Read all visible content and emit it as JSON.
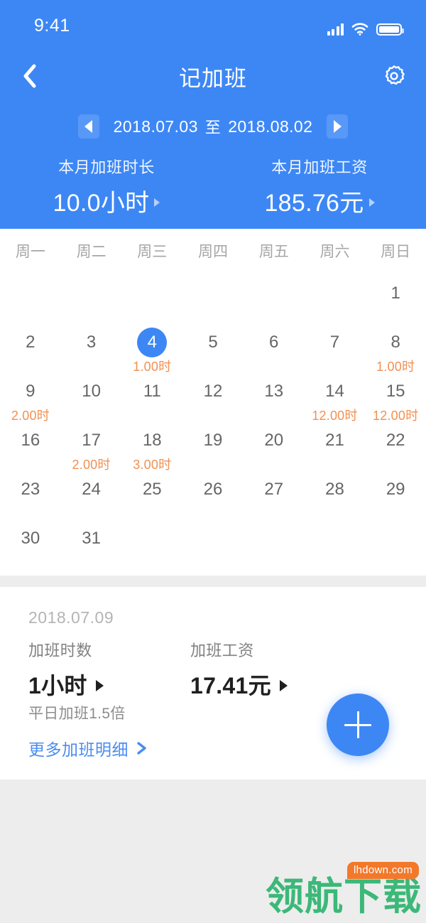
{
  "status_bar": {
    "time": "9:41",
    "signal_icon": "signal-bars-icon",
    "wifi_icon": "wifi-icon",
    "battery_icon": "battery-icon"
  },
  "nav": {
    "back_icon": "chevron-left-icon",
    "title": "记加班",
    "settings_icon": "gear-icon"
  },
  "date_range": {
    "prev_icon": "triangle-left-icon",
    "next_icon": "triangle-right-icon",
    "start": "2018.07.03",
    "separator": "至",
    "end": "2018.08.02"
  },
  "summary": [
    {
      "label": "本月加班时长",
      "value": "10.0小时",
      "caret_icon": "caret-right-icon"
    },
    {
      "label": "本月加班工资",
      "value": "185.76元",
      "caret_icon": "caret-right-icon"
    }
  ],
  "calendar": {
    "weekdays": [
      "周一",
      "周二",
      "周三",
      "周四",
      "周五",
      "周六",
      "周日"
    ],
    "weeks": [
      [
        {
          "day": ""
        },
        {
          "day": ""
        },
        {
          "day": ""
        },
        {
          "day": ""
        },
        {
          "day": ""
        },
        {
          "day": ""
        },
        {
          "day": "1",
          "hours": ""
        }
      ],
      [
        {
          "day": "2",
          "hours": ""
        },
        {
          "day": "3",
          "hours": ""
        },
        {
          "day": "4",
          "hours": "1.00时",
          "selected": true
        },
        {
          "day": "5",
          "hours": ""
        },
        {
          "day": "6",
          "hours": ""
        },
        {
          "day": "7",
          "hours": ""
        },
        {
          "day": "8",
          "hours": "1.00时"
        }
      ],
      [
        {
          "day": "9",
          "hours": "2.00时"
        },
        {
          "day": "10",
          "hours": ""
        },
        {
          "day": "11",
          "hours": ""
        },
        {
          "day": "12",
          "hours": ""
        },
        {
          "day": "13",
          "hours": ""
        },
        {
          "day": "14",
          "hours": "12.00时"
        },
        {
          "day": "15",
          "hours": "12.00时"
        }
      ],
      [
        {
          "day": "16",
          "hours": ""
        },
        {
          "day": "17",
          "hours": "2.00时"
        },
        {
          "day": "18",
          "hours": "3.00时"
        },
        {
          "day": "19",
          "hours": ""
        },
        {
          "day": "20",
          "hours": ""
        },
        {
          "day": "21",
          "hours": ""
        },
        {
          "day": "22",
          "hours": ""
        }
      ],
      [
        {
          "day": "23",
          "hours": ""
        },
        {
          "day": "24",
          "hours": ""
        },
        {
          "day": "25",
          "hours": ""
        },
        {
          "day": "26",
          "hours": ""
        },
        {
          "day": "27",
          "hours": ""
        },
        {
          "day": "28",
          "hours": ""
        },
        {
          "day": "29",
          "hours": ""
        }
      ],
      [
        {
          "day": "30",
          "hours": ""
        },
        {
          "day": "31",
          "hours": ""
        },
        {
          "day": ""
        },
        {
          "day": ""
        },
        {
          "day": ""
        },
        {
          "day": ""
        },
        {
          "day": ""
        }
      ]
    ]
  },
  "detail": {
    "date": "2018.07.09",
    "hours_label": "加班时数",
    "hours_value": "1小时",
    "hours_caret_icon": "caret-right-icon",
    "wage_label": "加班工资",
    "wage_value": "17.41元",
    "wage_caret_icon": "caret-right-icon",
    "note": "平日加班1.5倍",
    "more_link": "更多加班明细",
    "more_icon": "chevron-right-icon"
  },
  "fab": {
    "icon": "plus-icon"
  },
  "watermark": {
    "text": "领航下载",
    "badge": "lhdown.com"
  },
  "colors": {
    "brand_blue": "#3d87f5",
    "overtime_orange": "#f29052",
    "link_blue": "#4a8cf0",
    "watermark_green": "#3cb878",
    "watermark_badge_orange": "#f2792b",
    "page_gray": "#ededed"
  }
}
